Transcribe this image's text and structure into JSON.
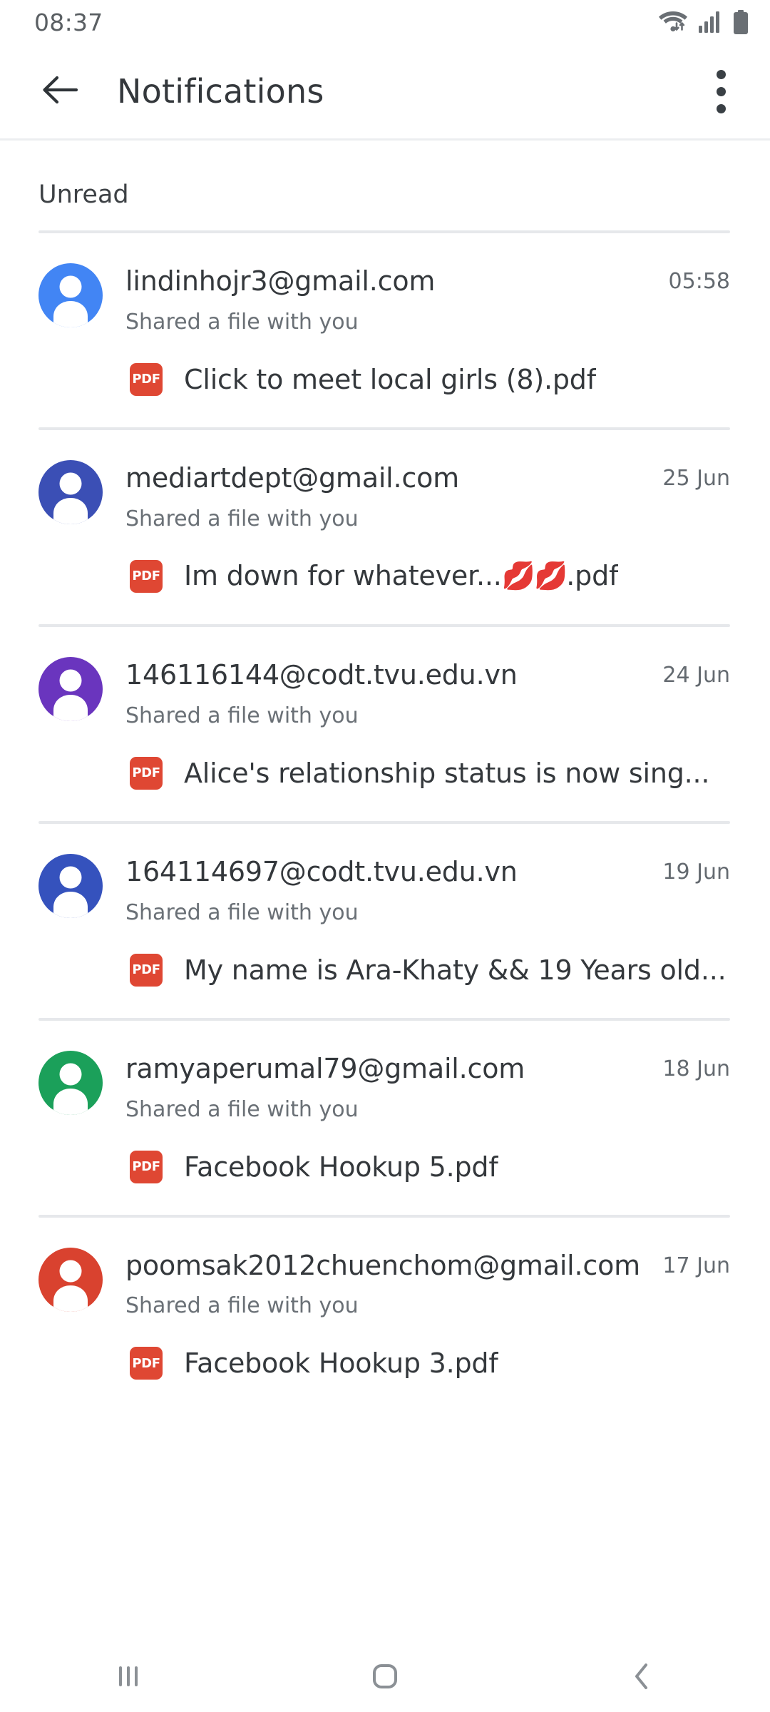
{
  "status_bar": {
    "time": "08:37",
    "icons": [
      "wifi-icon",
      "cellular-signal-icon",
      "battery-icon"
    ]
  },
  "app_bar": {
    "back_icon": "arrow-left-icon",
    "title": "Notifications",
    "overflow_icon": "more-vertical-icon"
  },
  "list": {
    "section_label": "Unread",
    "shared_subtitle": "Shared a file with you",
    "pdf_badge_label": "PDF",
    "items": [
      {
        "sender": "lindinhojr3@gmail.com",
        "time": "05:58",
        "subtitle": "Shared a file with you",
        "filename": "Click to meet local girls (8).pdf",
        "avatar_color": "#4285F4"
      },
      {
        "sender": "mediartdept@gmail.com",
        "time": "25 Jun",
        "subtitle": "Shared a file with you",
        "filename_prefix": "Im down for whatever...",
        "filename_emoji": "💋💋",
        "filename_suffix": ".pdf",
        "filename": "Im down for whatever...💋💋.pdf",
        "avatar_color": "#3B4FB5"
      },
      {
        "sender": "146116144@codt.tvu.edu.vn",
        "time": "24 Jun",
        "subtitle": "Shared a file with you",
        "filename": "Alice's relationship status is now sing...",
        "avatar_color": "#6A35BE"
      },
      {
        "sender": "164114697@codt.tvu.edu.vn",
        "time": "19 Jun",
        "subtitle": "Shared a file with you",
        "filename": "My name is Ara-Khaty && 19 Years old...",
        "avatar_color": "#3552BD"
      },
      {
        "sender": "ramyaperumal79@gmail.com",
        "time": "18 Jun",
        "subtitle": "Shared a file with you",
        "filename": "Facebook Hookup 5.pdf",
        "avatar_color": "#1BA05A"
      },
      {
        "sender": "poomsak2012chuenchom@gmail.com",
        "time": "17 Jun",
        "subtitle": "Shared a file with you",
        "filename": "Facebook Hookup 3.pdf",
        "avatar_color": "#D9422F"
      }
    ]
  },
  "nav_bar": {
    "recents_icon": "recents-icon",
    "home_icon": "home-icon",
    "back_icon": "back-chevron-icon"
  }
}
